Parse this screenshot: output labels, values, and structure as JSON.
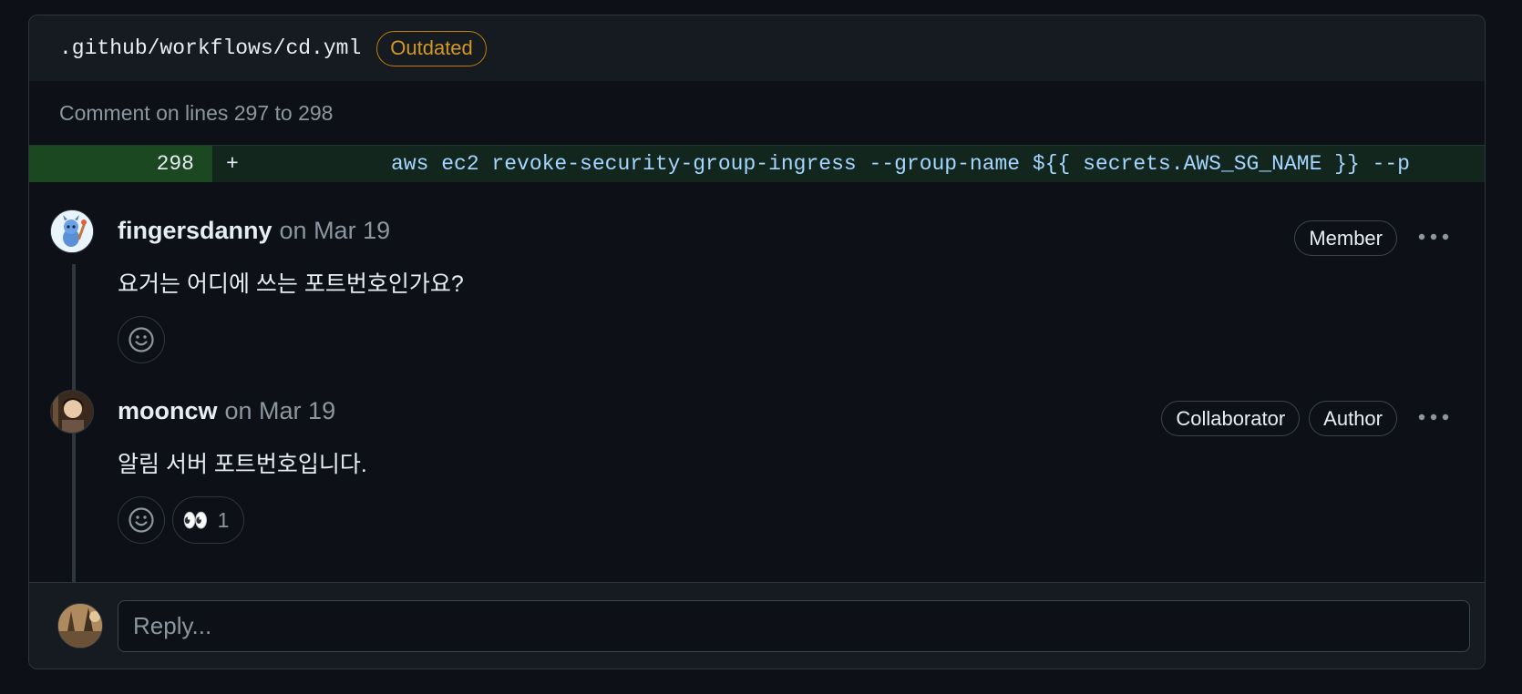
{
  "file": {
    "path": ".github/workflows/cd.yml",
    "status_badge": "Outdated"
  },
  "comment_range": "Comment on lines 297 to 298",
  "diff": {
    "line_number": "298",
    "sign": "+",
    "code": "aws ec2 revoke-security-group-ingress --group-name ${{ secrets.AWS_SG_NAME }} --p"
  },
  "comments": [
    {
      "author": "fingersdanny",
      "date": "on Mar 19",
      "badges": [
        "Member"
      ],
      "body": "요거는 어디에 쓰는 포트번호인가요?"
    },
    {
      "author": "mooncw",
      "date": "on Mar 19",
      "badges": [
        "Collaborator",
        "Author"
      ],
      "body": "알림 서버 포트번호입니다.",
      "reaction": {
        "emoji": "👀",
        "count": "1"
      }
    }
  ],
  "reply": {
    "placeholder": "Reply..."
  },
  "icons": {
    "more": "kebab-horizontal-icon",
    "add_reaction": "smiley-icon"
  },
  "colors": {
    "background": "#0d1117",
    "outdated": "#d29922",
    "diff_added": "#1b4721"
  }
}
